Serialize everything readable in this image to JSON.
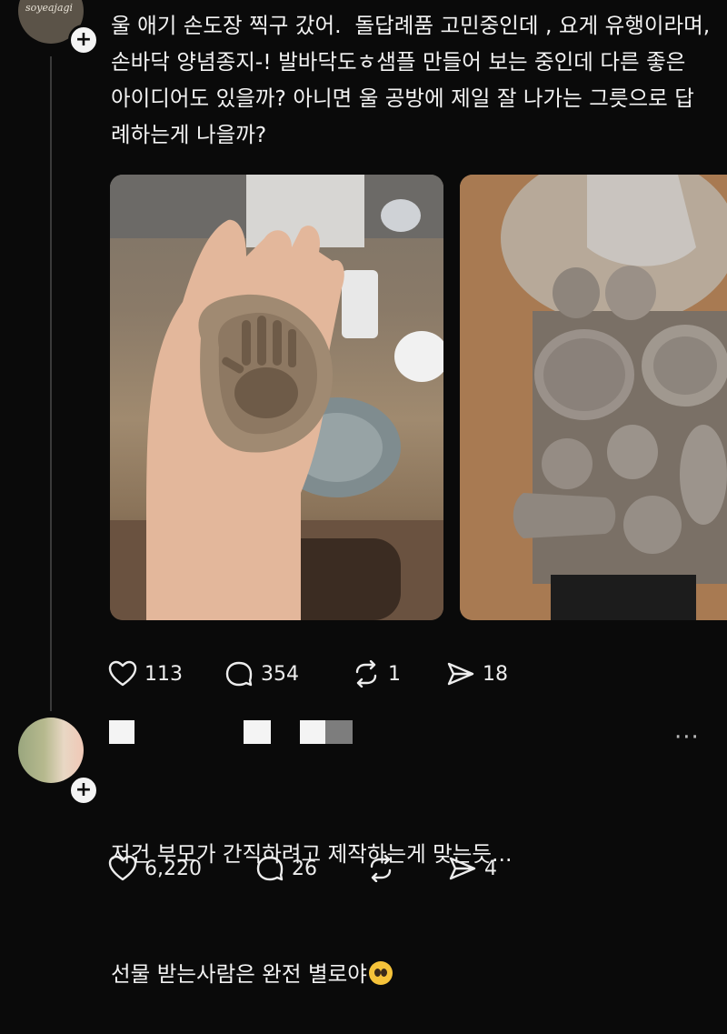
{
  "post": {
    "avatar_text": "soyeajagi",
    "text": "울 애기 손도장 찍구 갔어.  돌답례품 고민중인데 , 요게 유행이라며,손바닥 양념종지-! 발바닥도ㅎ샘플 만들어 보는 중인데 다른 좋은 아이디어도 있을까? 아니면 울 공방에 제일 잘 나가는 그릇으로 답례하는게 나을까?",
    "likes": "113",
    "comments": "354",
    "reposts": "1",
    "shares": "18"
  },
  "reply": {
    "text_line1": "저건 부모가 간직하려고 제작하는게 맞는듯...",
    "text_line2": "선물 받는사람은 완전 별로야",
    "emoji": "pleading-face",
    "more": "···",
    "likes": "6,220",
    "comments": "26",
    "reposts": "",
    "shares": "4"
  },
  "colors": {
    "background": "#0a0a0a",
    "text": "#f2f2f2",
    "line": "#3a3a3a"
  }
}
